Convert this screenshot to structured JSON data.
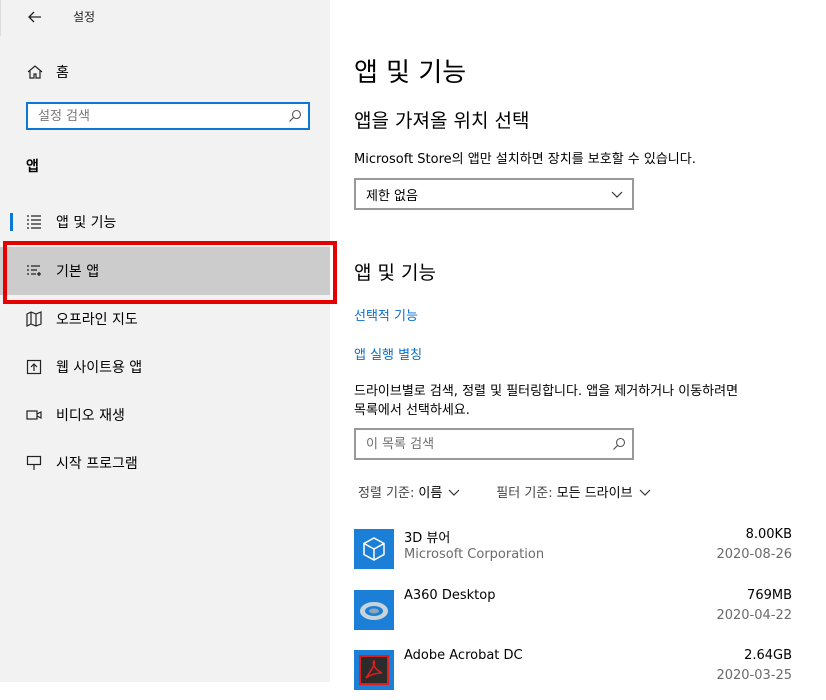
{
  "window": {
    "title": "설정"
  },
  "sidebar": {
    "home_label": "홈",
    "search_placeholder": "설정 검색",
    "section_title": "앱",
    "items": [
      {
        "label": "앱 및 기능",
        "icon": "apps-features-icon"
      },
      {
        "label": "기본 앱",
        "icon": "default-apps-icon"
      },
      {
        "label": "오프라인 지도",
        "icon": "offline-maps-icon"
      },
      {
        "label": "웹 사이트용 앱",
        "icon": "apps-for-websites-icon"
      },
      {
        "label": "비디오 재생",
        "icon": "video-playback-icon"
      },
      {
        "label": "시작 프로그램",
        "icon": "startup-icon"
      }
    ]
  },
  "main": {
    "title": "앱 및 기능",
    "choose_section": {
      "heading": "앱을 가져올 위치 선택",
      "description": "Microsoft Store의 앱만 설치하면 장치를 보호할 수 있습니다.",
      "dropdown_value": "제한 없음"
    },
    "apps_section": {
      "heading": "앱 및 기능",
      "link_optional": "선택적 기능",
      "link_aliases": "앱 실행 별칭",
      "description_line1": "드라이브별로 검색, 정렬 및 필터링합니다. 앱을 제거하거나 이동하려면",
      "description_line2": "목록에서 선택하세요.",
      "search_placeholder": "이 목록 검색",
      "sort_key": "정렬 기준:",
      "sort_value": "이름",
      "filter_key": "필터 기준:",
      "filter_value": "모든 드라이브"
    },
    "apps": [
      {
        "name": "3D 뷰어",
        "publisher": "Microsoft Corporation",
        "size": "8.00KB",
        "date": "2020-08-26"
      },
      {
        "name": "A360 Desktop",
        "publisher": "",
        "size": "769MB",
        "date": "2020-04-22"
      },
      {
        "name": "Adobe Acrobat DC",
        "publisher": "",
        "size": "2.64GB",
        "date": "2020-03-25"
      }
    ]
  },
  "colors": {
    "accent": "#0a78d4",
    "highlight": "#e60000",
    "sidebar_bg": "#f2f2f2"
  }
}
